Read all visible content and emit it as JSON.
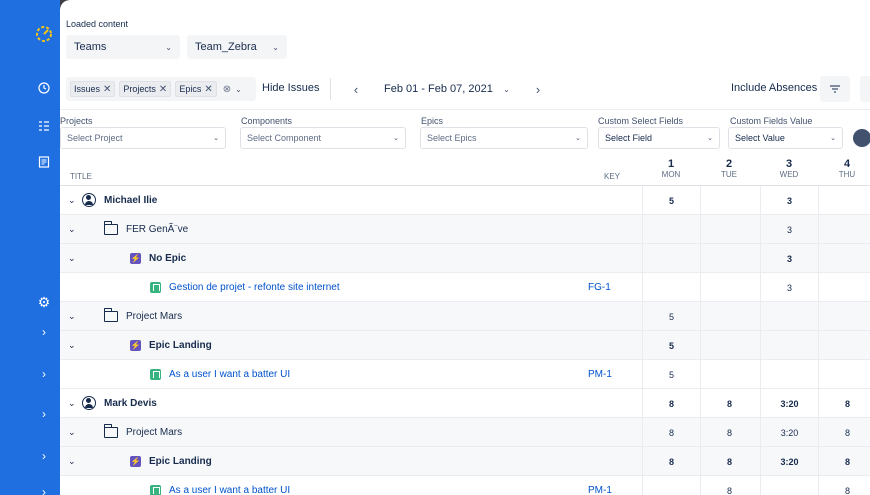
{
  "header": {
    "loaded_label": "Loaded content",
    "group_type": "Teams",
    "group_value": "Team_Zebra"
  },
  "toolbar": {
    "chips": [
      "Issues",
      "Projects",
      "Epics"
    ],
    "hide_label": "Hide Issues",
    "date_range": "Feb 01 - Feb 07, 2021",
    "include_label": "Include Absences"
  },
  "filters": {
    "projects_label": "Projects",
    "projects_placeholder": "Select Project",
    "components_label": "Components",
    "components_placeholder": "Select Component",
    "epics_label": "Epics",
    "epics_placeholder": "Select Epics",
    "custom_fields_label": "Custom Select Fields",
    "custom_fields_value": "Select Field",
    "custom_values_label": "Custom Fields Value",
    "custom_values_value": "Select Value"
  },
  "columns": {
    "title": "TITLE",
    "key": "KEY",
    "days": [
      {
        "num": "1",
        "name": "MON"
      },
      {
        "num": "2",
        "name": "TUE"
      },
      {
        "num": "3",
        "name": "WED"
      },
      {
        "num": "4",
        "name": "THU"
      }
    ]
  },
  "rows": [
    {
      "level": 0,
      "type": "user",
      "title": "Michael Ilie",
      "key": "",
      "cells": [
        "5",
        "",
        "3",
        ""
      ],
      "bold": true
    },
    {
      "level": 1,
      "type": "project",
      "title": "FER GenÃ¨ve",
      "key": "",
      "cells": [
        "",
        "",
        "3",
        ""
      ],
      "bold": false
    },
    {
      "level": 2,
      "type": "epic",
      "title": "No Epic",
      "key": "",
      "cells": [
        "",
        "",
        "3",
        ""
      ],
      "bold": true
    },
    {
      "level": 3,
      "type": "story",
      "title": "Gestion de projet - refonte site internet",
      "key": "FG-1",
      "cells": [
        "",
        "",
        "3",
        ""
      ],
      "bold": false
    },
    {
      "level": 1,
      "type": "project",
      "title": "Project Mars",
      "key": "",
      "cells": [
        "5",
        "",
        "",
        ""
      ],
      "bold": false
    },
    {
      "level": 2,
      "type": "epic",
      "title": "Epic Landing",
      "key": "",
      "cells": [
        "5",
        "",
        "",
        ""
      ],
      "bold": true
    },
    {
      "level": 3,
      "type": "story",
      "title": "As a user I want a batter UI",
      "key": "PM-1",
      "cells": [
        "5",
        "",
        "",
        ""
      ],
      "bold": false
    },
    {
      "level": 0,
      "type": "user",
      "title": "Mark Devis",
      "key": "",
      "cells": [
        "8",
        "8",
        "3:20",
        "8"
      ],
      "bold": true
    },
    {
      "level": 1,
      "type": "project",
      "title": "Project Mars",
      "key": "",
      "cells": [
        "8",
        "8",
        "3:20",
        "8"
      ],
      "bold": false
    },
    {
      "level": 2,
      "type": "epic",
      "title": "Epic Landing",
      "key": "",
      "cells": [
        "8",
        "8",
        "3:20",
        "8"
      ],
      "bold": true
    },
    {
      "level": 3,
      "type": "story",
      "title": "As a user I want a batter UI",
      "key": "PM-1",
      "cells": [
        "",
        "8",
        "",
        "8"
      ],
      "bold": false
    }
  ]
}
